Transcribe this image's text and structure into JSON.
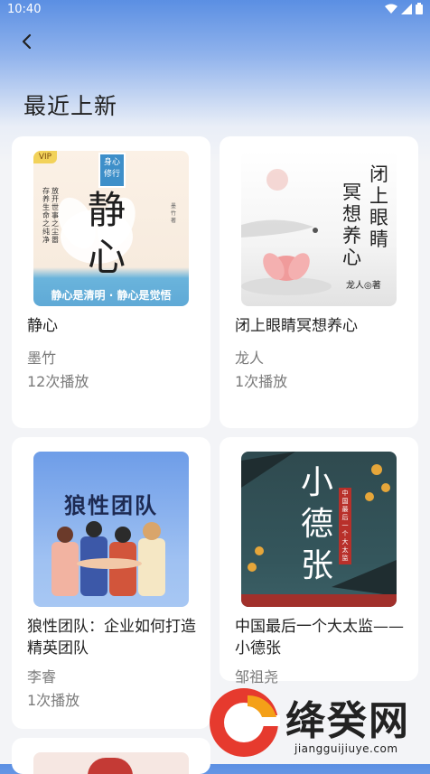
{
  "status": {
    "time": "10:40"
  },
  "header": {
    "title": "最近上新"
  },
  "books": [
    {
      "title": "静心",
      "author": "墨竹",
      "plays": "12次播放",
      "cover": {
        "badge": "VIP",
        "main": "静心",
        "tag": "身心修行",
        "sub1": "放开世事之尘嚣",
        "sub2": "存养生命之纯净",
        "author_small": "墨竹 著",
        "banner": "静心是清明 · 静心是觉悟"
      }
    },
    {
      "title": "闭上眼睛冥想养心",
      "author": "龙人",
      "plays": "1次播放",
      "cover": {
        "line1": "闭上眼睛",
        "line2": "冥想养心",
        "author_small": "龙人◎著"
      }
    },
    {
      "title": "狼性团队：企业如何打造精英团队",
      "author": "李睿",
      "plays": "1次播放",
      "cover": {
        "main": "狼性团队"
      }
    },
    {
      "title": "中国最后一个大太监——小德张",
      "author": "邹祖尧",
      "plays": "",
      "cover": {
        "main": "小德张",
        "side": "中国最后一个大太监"
      }
    }
  ],
  "watermark": {
    "brand": "绛癸网",
    "url": "jiangguijiuye.com"
  }
}
